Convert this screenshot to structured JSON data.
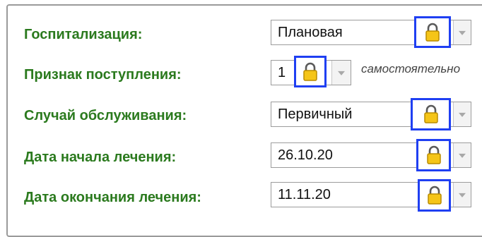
{
  "fields": [
    {
      "label": "Госпитализация:",
      "value": "Плановая"
    },
    {
      "label": "Признак поступления:",
      "value": "1",
      "hint": "самостоятельно"
    },
    {
      "label": "Случай обслуживания:",
      "value": "Первичный"
    },
    {
      "label": "Дата начала лечения:",
      "value": "26.10.20"
    },
    {
      "label": "Дата окончания лечения:",
      "value": "11.11.20"
    }
  ],
  "colors": {
    "label": "#2b7a1e",
    "highlight_border": "#1f3ff2",
    "lock_fill": "#f5c518"
  },
  "icons": {
    "lock": "lock-icon",
    "dropdown": "chevron-down-icon"
  }
}
